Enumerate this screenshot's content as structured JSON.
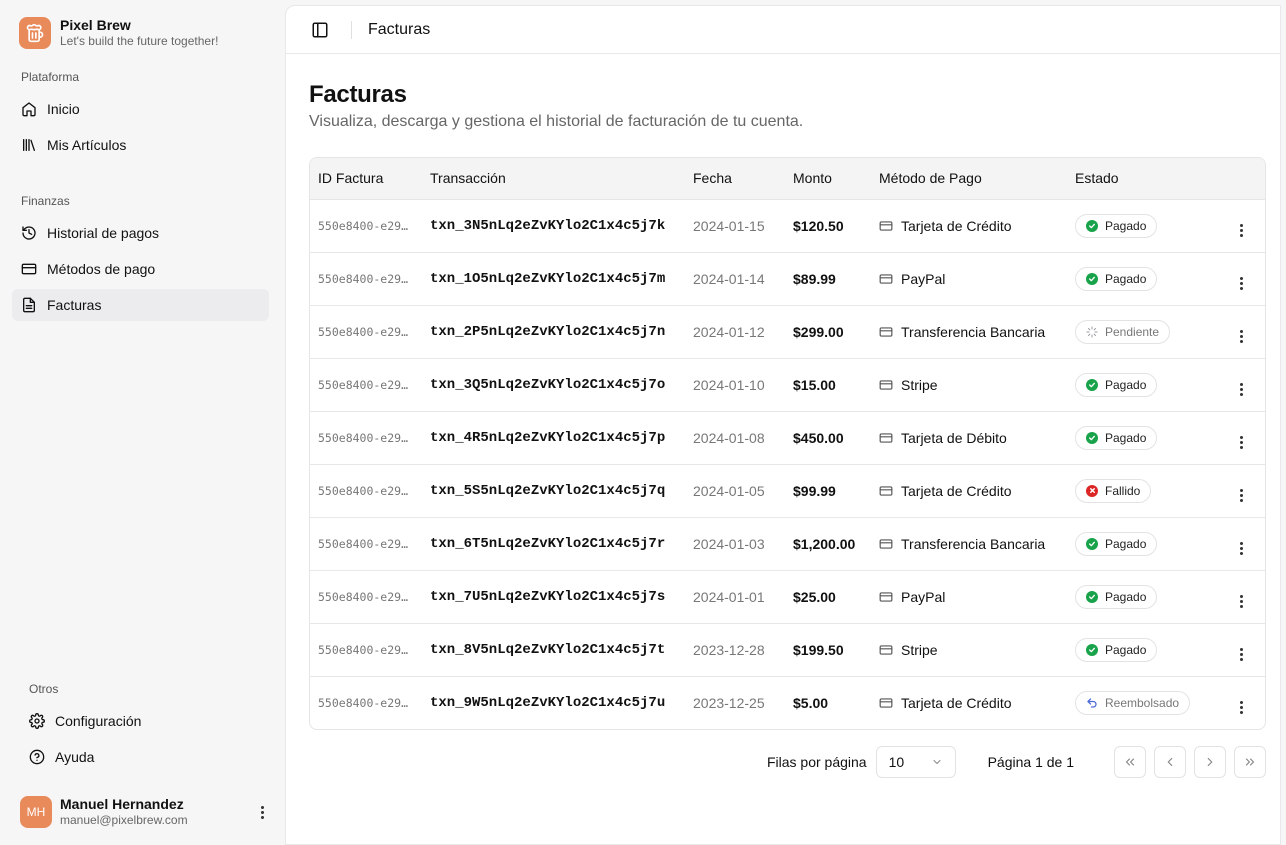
{
  "brand": {
    "name": "Pixel Brew",
    "tagline": "Let's build the future together!",
    "logo_icon": "beer-mug-icon",
    "color": "#e98a5a"
  },
  "sidebar": {
    "plataforma": {
      "label": "Plataforma",
      "items": [
        {
          "label": "Inicio",
          "icon": "home-icon"
        },
        {
          "label": "Mis Artículos",
          "icon": "library-icon"
        }
      ]
    },
    "finanzas": {
      "label": "Finanzas",
      "items": [
        {
          "label": "Historial de pagos",
          "icon": "history-icon"
        },
        {
          "label": "Métodos de pago",
          "icon": "credit-card-icon"
        },
        {
          "label": "Facturas",
          "icon": "file-icon",
          "active": true
        }
      ]
    },
    "otros": {
      "label": "Otros",
      "items": [
        {
          "label": "Configuración",
          "icon": "gear-icon"
        },
        {
          "label": "Ayuda",
          "icon": "help-circle-icon"
        }
      ]
    }
  },
  "user": {
    "initials": "MH",
    "name": "Manuel Hernandez",
    "email": "manuel@pixelbrew.com"
  },
  "header": {
    "breadcrumb": "Facturas"
  },
  "page": {
    "title": "Facturas",
    "subtitle": "Visualiza, descarga y gestiona el historial de facturación de tu cuenta."
  },
  "table": {
    "columns": [
      "ID Factura",
      "Transacción",
      "Fecha",
      "Monto",
      "Método de Pago",
      "Estado"
    ],
    "rows": [
      {
        "id": "550e8400-e29…",
        "txn": "txn_3N5nLq2eZvKYlo2C1x4c5j7k",
        "date": "2024-01-15",
        "amount": "$120.50",
        "method": "Tarjeta de Crédito",
        "status": "Pagado",
        "status_type": "ok"
      },
      {
        "id": "550e8400-e29…",
        "txn": "txn_1O5nLq2eZvKYlo2C1x4c5j7m",
        "date": "2024-01-14",
        "amount": "$89.99",
        "method": "PayPal",
        "status": "Pagado",
        "status_type": "ok"
      },
      {
        "id": "550e8400-e29…",
        "txn": "txn_2P5nLq2eZvKYlo2C1x4c5j7n",
        "date": "2024-01-12",
        "amount": "$299.00",
        "method": "Transferencia Bancaria",
        "status": "Pendiente",
        "status_type": "pending"
      },
      {
        "id": "550e8400-e29…",
        "txn": "txn_3Q5nLq2eZvKYlo2C1x4c5j7o",
        "date": "2024-01-10",
        "amount": "$15.00",
        "method": "Stripe",
        "status": "Pagado",
        "status_type": "ok"
      },
      {
        "id": "550e8400-e29…",
        "txn": "txn_4R5nLq2eZvKYlo2C1x4c5j7p",
        "date": "2024-01-08",
        "amount": "$450.00",
        "method": "Tarjeta de Débito",
        "status": "Pagado",
        "status_type": "ok"
      },
      {
        "id": "550e8400-e29…",
        "txn": "txn_5S5nLq2eZvKYlo2C1x4c5j7q",
        "date": "2024-01-05",
        "amount": "$99.99",
        "method": "Tarjeta de Crédito",
        "status": "Fallido",
        "status_type": "failed"
      },
      {
        "id": "550e8400-e29…",
        "txn": "txn_6T5nLq2eZvKYlo2C1x4c5j7r",
        "date": "2024-01-03",
        "amount": "$1,200.00",
        "method": "Transferencia Bancaria",
        "status": "Pagado",
        "status_type": "ok"
      },
      {
        "id": "550e8400-e29…",
        "txn": "txn_7U5nLq2eZvKYlo2C1x4c5j7s",
        "date": "2024-01-01",
        "amount": "$25.00",
        "method": "PayPal",
        "status": "Pagado",
        "status_type": "ok"
      },
      {
        "id": "550e8400-e29…",
        "txn": "txn_8V5nLq2eZvKYlo2C1x4c5j7t",
        "date": "2023-12-28",
        "amount": "$199.50",
        "method": "Stripe",
        "status": "Pagado",
        "status_type": "ok"
      },
      {
        "id": "550e8400-e29…",
        "txn": "txn_9W5nLq2eZvKYlo2C1x4c5j7u",
        "date": "2023-12-25",
        "amount": "$5.00",
        "method": "Tarjeta de Crédito",
        "status": "Reembolsado",
        "status_type": "refunded"
      }
    ]
  },
  "pagination": {
    "rows_label": "Filas por página",
    "rows_value": "10",
    "page_info": "Página 1 de 1"
  },
  "colors": {
    "ok": "#18a34a",
    "failed": "#dc2626",
    "pending": "#9a9aa0",
    "refunded": "#4b6bd6"
  }
}
